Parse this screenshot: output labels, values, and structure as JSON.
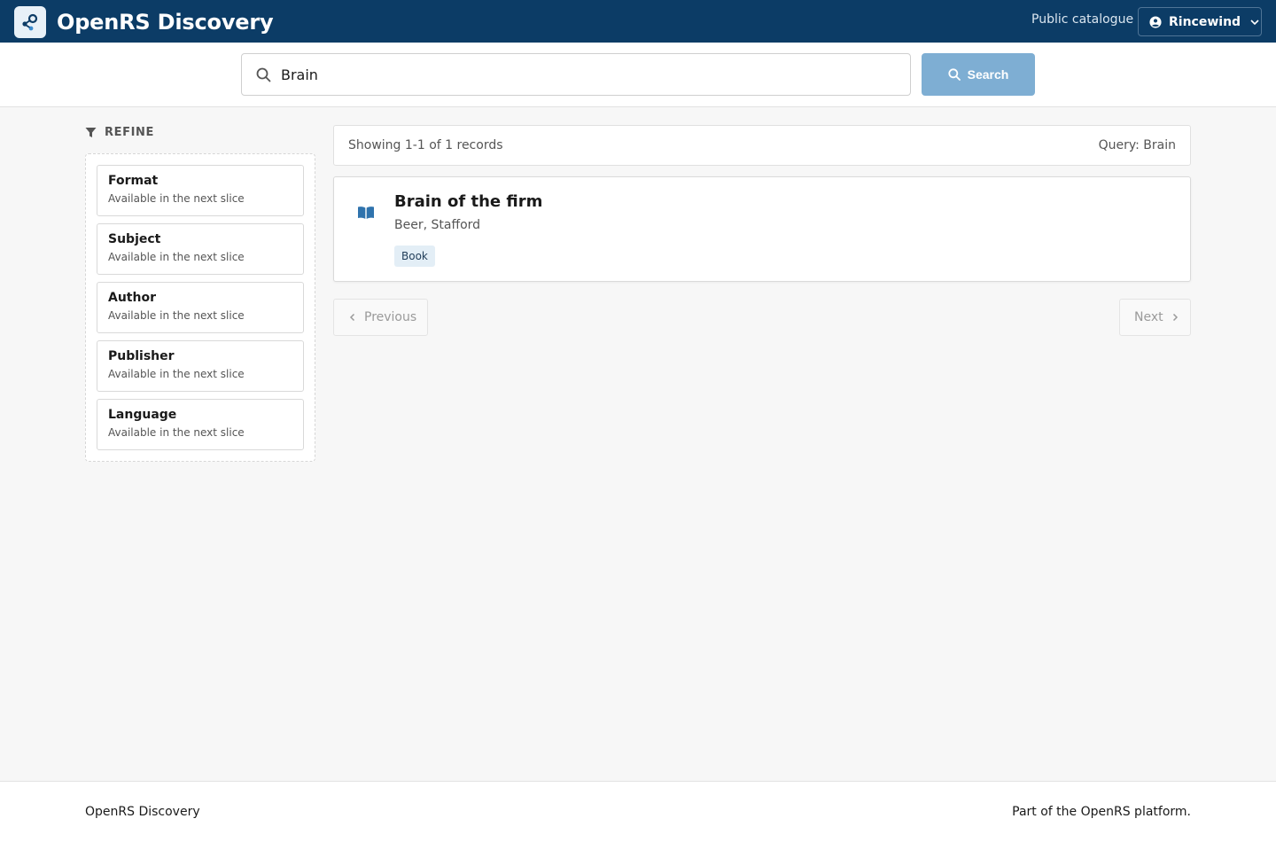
{
  "header": {
    "app_name": "OpenRS Discovery",
    "public_link": "Public catalogue",
    "user_name": "Rincewind",
    "logo_icon": "share-node-icon",
    "user_icon": "user-circle-icon"
  },
  "search": {
    "query": "Brain",
    "button_label": "Search"
  },
  "refine": {
    "heading": "REFINE",
    "facets": [
      {
        "title": "Format",
        "subtitle": "Available in the next slice"
      },
      {
        "title": "Subject",
        "subtitle": "Available in the next slice"
      },
      {
        "title": "Author",
        "subtitle": "Available in the next slice"
      },
      {
        "title": "Publisher",
        "subtitle": "Available in the next slice"
      },
      {
        "title": "Language",
        "subtitle": "Available in the next slice"
      }
    ]
  },
  "results": {
    "summary": "Showing 1-1 of 1 records",
    "query_label": "Query: Brain",
    "items": [
      {
        "title": "Brain of the firm",
        "author": "Beer, Stafford",
        "format": "Book",
        "icon": "book-open-icon"
      }
    ]
  },
  "pagination": {
    "previous_label": "Previous",
    "next_label": "Next"
  },
  "footer": {
    "left": "OpenRS Discovery",
    "right": "Part of the OpenRS platform."
  },
  "colors": {
    "header_bg": "#0c3c66",
    "search_button": "#7eaed3",
    "badge_bg": "#e3eef6",
    "book_icon": "#2f73ad"
  }
}
